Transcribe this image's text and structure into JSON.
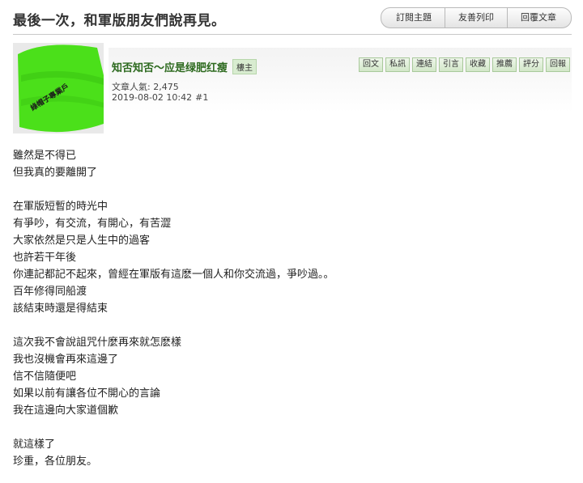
{
  "page": {
    "title": "最後一次，和軍版朋友們說再見。"
  },
  "top_actions": [
    "訂閱主題",
    "友善列印",
    "回覆文章"
  ],
  "post": {
    "author": "知否知否～应是绿肥红瘦",
    "badge": "樓主",
    "actions": [
      "回文",
      "私訊",
      "連結",
      "引言",
      "收藏",
      "推薦",
      "評分",
      "回報"
    ],
    "popularity_label": "文章人氣: ",
    "popularity_value": "2,475",
    "datetime": "2019-08-02 10:42",
    "floor": "#1",
    "avatar_text": "綠帽子專業戶",
    "avatar_colors": {
      "hat": "#4be01a",
      "hat_dark": "#2fae0c",
      "bg": "#e9e9e9"
    }
  },
  "content": {
    "paragraphs": [
      [
        "雖然是不得已",
        "但我真的要離開了"
      ],
      [
        "在軍版短暫的時光中",
        "有爭吵，有交流，有開心，有苦澀",
        "大家依然是只是人生中的過客",
        "也許若干年後",
        "你連記都記不起來，曾經在軍版有這麽一個人和你交流過，爭吵過。。",
        "百年修得同船渡",
        "該結束時還是得結束"
      ],
      [
        "這次我不會說詛咒什麼再來就怎麽樣",
        "我也沒機會再來這邊了",
        "信不信隨便吧",
        "如果以前有讓各位不開心的言論",
        "我在這邊向大家道個歉"
      ],
      [
        "就這樣了",
        "珍重，各位朋友。"
      ]
    ]
  }
}
